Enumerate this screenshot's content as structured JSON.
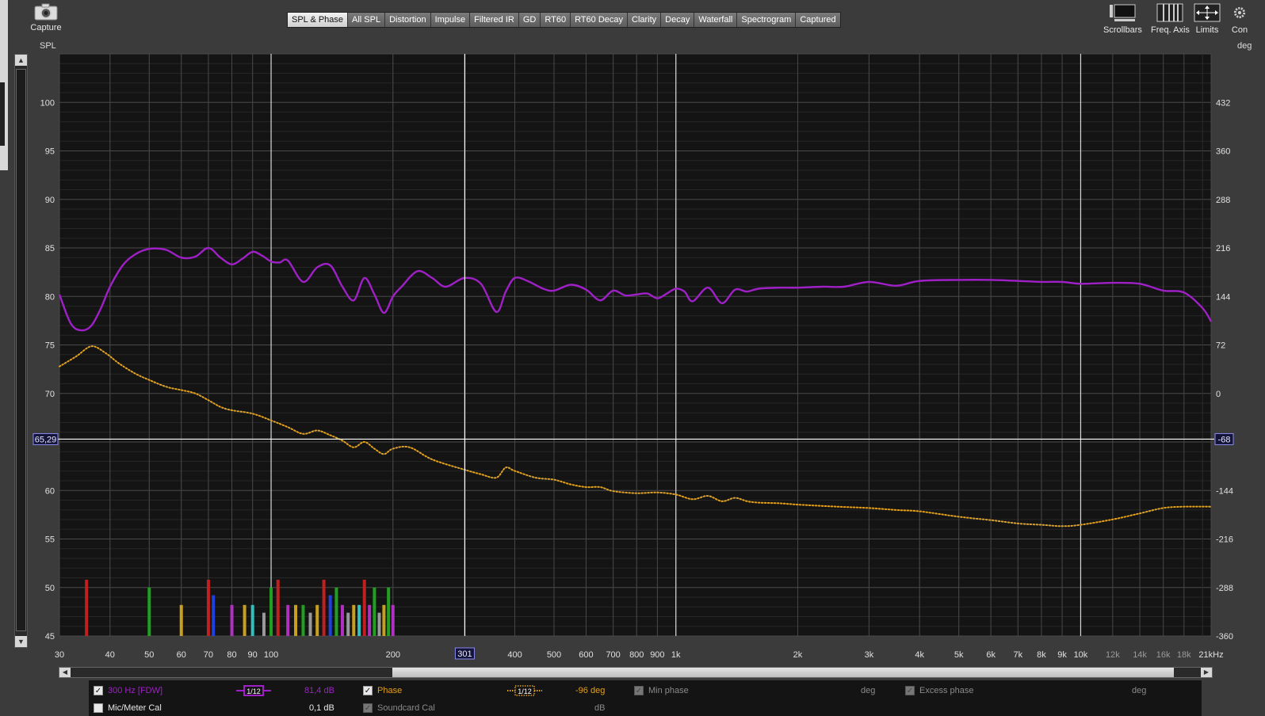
{
  "toolbar": {
    "capture_label": "Capture",
    "tabs": [
      {
        "label": "SPL & Phase",
        "active": true
      },
      {
        "label": "All SPL",
        "active": false
      },
      {
        "label": "Distortion",
        "active": false
      },
      {
        "label": "Impulse",
        "active": false
      },
      {
        "label": "Filtered IR",
        "active": false
      },
      {
        "label": "GD",
        "active": false
      },
      {
        "label": "RT60",
        "active": false
      },
      {
        "label": "RT60 Decay",
        "active": false
      },
      {
        "label": "Clarity",
        "active": false
      },
      {
        "label": "Decay",
        "active": false
      },
      {
        "label": "Waterfall",
        "active": false
      },
      {
        "label": "Spectrogram",
        "active": false
      },
      {
        "label": "Captured",
        "active": false
      }
    ],
    "right_tools": {
      "scrollbars": "Scrollbars",
      "freq_axis": "Freq. Axis",
      "limits": "Limits",
      "controls": "Con"
    }
  },
  "chart_data": {
    "type": "line",
    "ylabel_left": "SPL",
    "ylabel_right": "deg",
    "x_scale": "log",
    "xlim": [
      30,
      21000
    ],
    "ylim": [
      45,
      105
    ],
    "y2lim": [
      -360,
      504
    ],
    "x_ticks": [
      "30",
      "40",
      "50",
      "60",
      "70",
      "80",
      "90",
      "100",
      "200",
      "400",
      "500",
      "600",
      "700",
      "800",
      "900",
      "1k",
      "2k",
      "3k",
      "4k",
      "5k",
      "6k",
      "7k",
      "8k",
      "9k",
      "10k",
      "12k",
      "14k",
      "16k",
      "18k",
      "21kHz"
    ],
    "x_tick_values": [
      30,
      40,
      50,
      60,
      70,
      80,
      90,
      100,
      200,
      400,
      500,
      600,
      700,
      800,
      900,
      1000,
      2000,
      3000,
      4000,
      5000,
      6000,
      7000,
      8000,
      9000,
      10000,
      12000,
      14000,
      16000,
      18000,
      21000
    ],
    "y_ticks": [
      45,
      50,
      55,
      60,
      65,
      70,
      75,
      80,
      85,
      90,
      95,
      100
    ],
    "y2_ticks": [
      -360,
      -288,
      -216,
      -144,
      -72,
      0,
      72,
      144,
      216,
      288,
      360,
      432
    ],
    "cursor": {
      "x": 301,
      "x_label": "301",
      "y_label": "65,29",
      "y2_label": "-68",
      "y": 65.29
    },
    "grid": true,
    "series": [
      {
        "name": "300 Hz [FDW]",
        "color": "#a020c8",
        "axis": "left",
        "x": [
          30,
          32,
          34,
          36,
          38,
          40,
          43,
          46,
          50,
          55,
          60,
          65,
          70,
          75,
          80,
          85,
          90,
          95,
          100,
          105,
          110,
          120,
          130,
          140,
          150,
          160,
          170,
          180,
          190,
          200,
          210,
          230,
          250,
          270,
          300,
          330,
          360,
          380,
          400,
          430,
          470,
          500,
          550,
          600,
          650,
          700,
          750,
          800,
          850,
          900,
          950,
          1000,
          1050,
          1100,
          1200,
          1300,
          1400,
          1500,
          1600,
          1800,
          2000,
          2300,
          2600,
          3000,
          3500,
          4000,
          5000,
          6000,
          7000,
          8000,
          9000,
          10000,
          12000,
          14000,
          16000,
          18000,
          20000,
          21000
        ],
        "values": [
          80.2,
          77.2,
          76.5,
          77.0,
          78.8,
          81.0,
          83.2,
          84.3,
          84.9,
          84.8,
          84.0,
          84.1,
          85.0,
          84.0,
          83.3,
          83.9,
          84.6,
          84.2,
          83.6,
          83.5,
          83.7,
          81.5,
          83.0,
          83.2,
          81.0,
          79.6,
          81.9,
          80.2,
          78.3,
          80.0,
          81.0,
          82.6,
          81.9,
          81.0,
          81.9,
          81.3,
          78.4,
          80.5,
          81.9,
          81.6,
          80.8,
          80.6,
          81.2,
          80.7,
          79.6,
          80.6,
          80.1,
          80.2,
          80.3,
          79.8,
          80.3,
          80.8,
          80.5,
          79.5,
          80.9,
          79.3,
          80.7,
          80.5,
          80.8,
          80.9,
          80.9,
          81.0,
          81.0,
          81.5,
          81.1,
          81.6,
          81.7,
          81.7,
          81.6,
          81.5,
          81.5,
          81.3,
          81.4,
          81.3,
          80.6,
          80.4,
          78.8,
          77.4
        ]
      },
      {
        "name": "Phase",
        "color": "#e0a020",
        "axis": "right",
        "style": "dotted",
        "x": [
          30,
          33,
          36,
          39,
          42,
          46,
          50,
          55,
          60,
          65,
          70,
          75,
          80,
          90,
          100,
          110,
          120,
          130,
          140,
          150,
          160,
          170,
          180,
          190,
          200,
          220,
          250,
          300,
          330,
          360,
          380,
          400,
          450,
          500,
          550,
          600,
          650,
          700,
          800,
          900,
          1000,
          1100,
          1200,
          1300,
          1400,
          1500,
          1600,
          1800,
          2000,
          2500,
          3000,
          3500,
          4000,
          5000,
          6000,
          7000,
          8000,
          9000,
          10000,
          12000,
          14000,
          16000,
          18000,
          21000
        ],
        "values": [
          40,
          55,
          70,
          60,
          45,
          30,
          20,
          10,
          5,
          0,
          -10,
          -20,
          -25,
          -30,
          -40,
          -50,
          -60,
          -55,
          -62,
          -70,
          -80,
          -72,
          -82,
          -90,
          -82,
          -80,
          -98,
          -113,
          -120,
          -125,
          -110,
          -115,
          -125,
          -128,
          -135,
          -139,
          -139,
          -145,
          -148,
          -147,
          -150,
          -157,
          -152,
          -160,
          -155,
          -160,
          -162,
          -163,
          -165,
          -168,
          -170,
          -173,
          -175,
          -183,
          -188,
          -193,
          -195,
          -197,
          -195,
          -187,
          -178,
          -170,
          -168,
          -168
        ]
      }
    ],
    "distortion_markers": {
      "x": [
        35,
        50,
        60,
        70,
        72,
        80,
        86,
        90,
        96,
        100,
        104,
        110,
        115,
        120,
        125,
        130,
        135,
        140,
        145,
        150,
        155,
        160,
        165,
        170,
        175,
        180,
        185,
        190,
        195,
        200
      ],
      "colors": [
        "#c02020",
        "#20a020",
        "#c8a020",
        "#c02020",
        "#2040e0",
        "#b030c0",
        "#c8a020",
        "#30c0c0",
        "#999999",
        "#20a020",
        "#c02020",
        "#b030c0",
        "#c8a020",
        "#20a020",
        "#999999",
        "#c8a020",
        "#c02020",
        "#2040e0",
        "#20a020",
        "#b030c0",
        "#999999",
        "#c8a020",
        "#30c0c0",
        "#c02020",
        "#b030c0",
        "#20a020",
        "#999999",
        "#c8a020",
        "#20a020",
        "#b030c0"
      ],
      "tops": [
        50.8,
        50.0,
        48.2,
        50.8,
        49.2,
        48.2,
        48.2,
        48.2,
        47.4,
        50.0,
        50.8,
        48.2,
        48.2,
        48.2,
        47.4,
        48.2,
        50.8,
        49.2,
        50.0,
        48.2,
        47.4,
        48.2,
        48.2,
        50.8,
        48.2,
        50.0,
        47.4,
        48.2,
        50.0,
        48.2
      ]
    }
  },
  "legend": {
    "spl": {
      "checked": true,
      "label": "300 Hz [FDW]",
      "smoothing": "1/12",
      "value": "81,4 dB",
      "color": "#a020c8"
    },
    "phase": {
      "checked": true,
      "label": "Phase",
      "smoothing": "1/12",
      "value": "-96 deg",
      "color": "#e0a020"
    },
    "min_phase": {
      "checked": true,
      "label": "Min phase",
      "unit": "deg"
    },
    "excess_phase": {
      "checked": true,
      "label": "Excess phase",
      "unit": "deg"
    },
    "mic_cal": {
      "checked": false,
      "label": "Mic/Meter Cal",
      "value": "0,1 dB"
    },
    "soundcard_cal": {
      "checked": true,
      "label": "Soundcard Cal",
      "unit": "dB"
    }
  }
}
